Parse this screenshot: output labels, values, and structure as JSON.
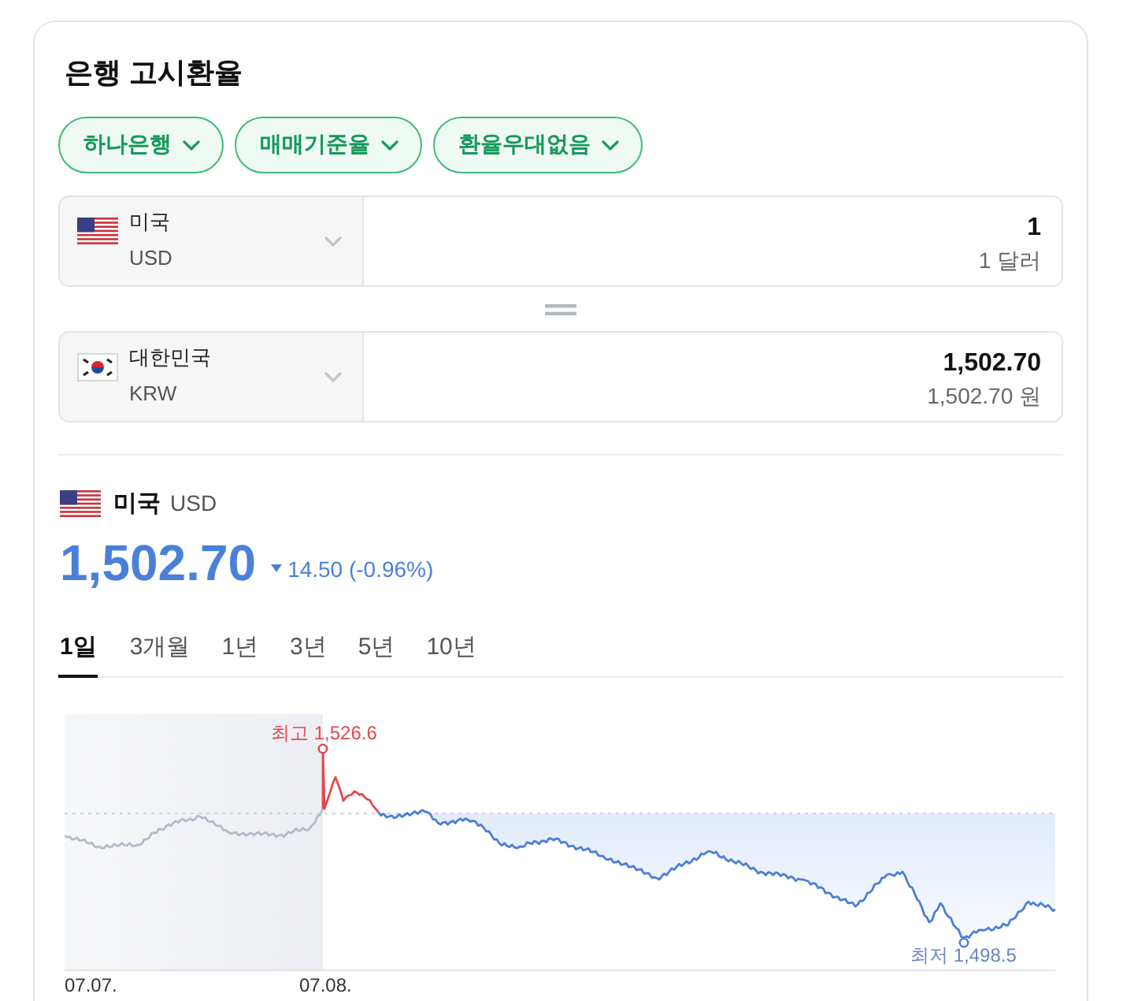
{
  "title": "은행 고시환율",
  "filters": [
    {
      "label": "하나은행"
    },
    {
      "label": "매매기준율"
    },
    {
      "label": "환율우대없음"
    }
  ],
  "converter": [
    {
      "country": "미국",
      "code": "USD",
      "amount": "1",
      "amount_words": "1 달러"
    },
    {
      "country": "대한민국",
      "code": "KRW",
      "amount": "1,502.70",
      "amount_words": "1,502.70 원"
    }
  ],
  "quote": {
    "country": "미국",
    "code": "USD",
    "rate": "1,502.70",
    "declining": true,
    "change": "14.50 (-0.96%)"
  },
  "periods": [
    {
      "label": "1일",
      "selected": true
    },
    {
      "label": "3개월",
      "selected": false
    },
    {
      "label": "1년",
      "selected": false
    },
    {
      "label": "3년",
      "selected": false
    },
    {
      "label": "5년",
      "selected": false
    },
    {
      "label": "10년",
      "selected": false
    }
  ],
  "chart": {
    "high_label": "최고 1,526.6",
    "low_label": "최저 1,498.5",
    "x_labels": [
      "07.07.",
      "07.08."
    ]
  }
}
